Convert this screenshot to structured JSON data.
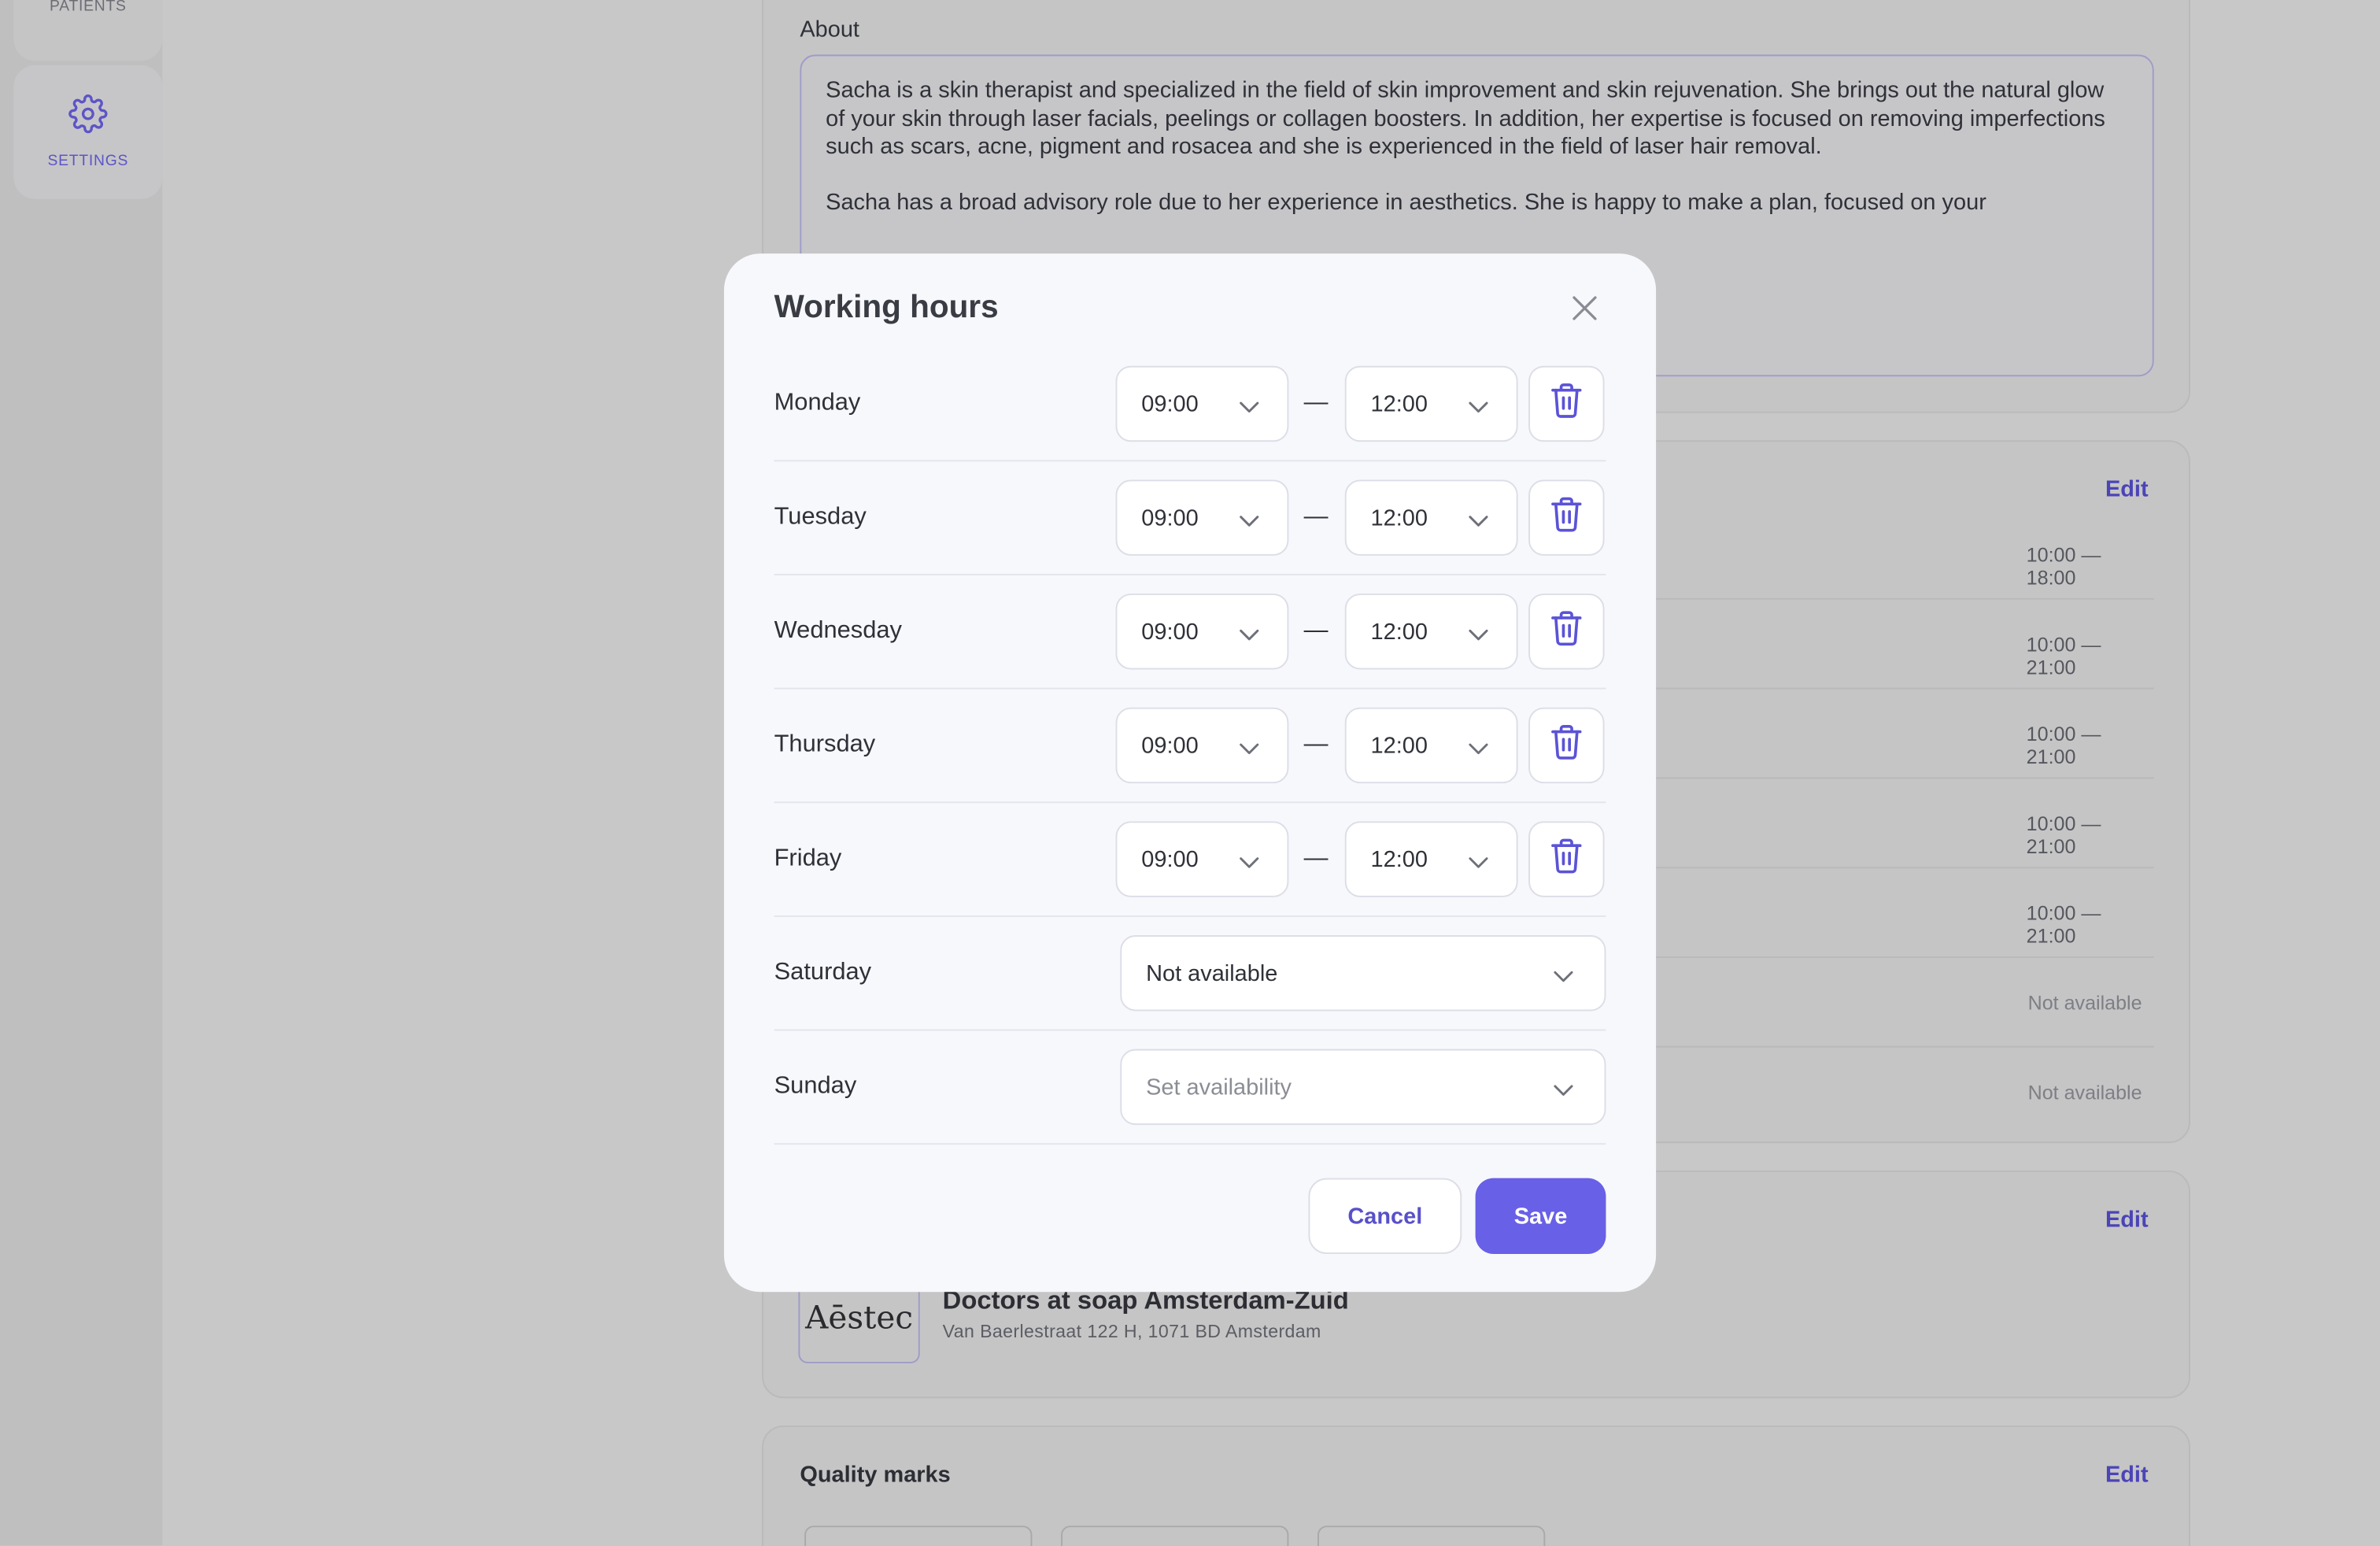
{
  "sidebar": {
    "patients_label": "PATIENTS",
    "settings_label": "SETTINGS",
    "settings_icon": "gear-icon"
  },
  "about": {
    "title": "About",
    "paragraph1": "Sacha is a skin therapist and specialized in the field of skin improvement and skin rejuvenation. She brings out the natural glow of your skin through laser facials, peelings or collagen boosters. In addition, her expertise is focused on removing imperfections such as scars, acne, pigment and rosacea and she is experienced in the field of laser hair removal.",
    "paragraph2": "Sacha has a broad advisory role due to her experience in aesthetics. She is happy to make a plan, focused on your"
  },
  "working_hours_panel": {
    "edit_label": "Edit",
    "hours": [
      "10:00 — 18:00",
      "10:00 — 21:00",
      "10:00 — 21:00",
      "10:00 — 21:00",
      "10:00 — 21:00",
      "Not available",
      "Not available"
    ]
  },
  "clinic_panel": {
    "edit_label": "Edit",
    "logo_text": "Aēstec",
    "name": "Doctors at soap Amsterdam-Zuid",
    "address": "Van Baerlestraat 122 H, 1071 BD Amsterdam"
  },
  "quality_marks": {
    "title": "Quality marks",
    "edit_label": "Edit"
  },
  "modal": {
    "title": "Working hours",
    "days": [
      {
        "day": "Monday",
        "from": "09:00",
        "to": "12:00"
      },
      {
        "day": "Tuesday",
        "from": "09:00",
        "to": "12:00"
      },
      {
        "day": "Wednesday",
        "from": "09:00",
        "to": "12:00"
      },
      {
        "day": "Thursday",
        "from": "09:00",
        "to": "12:00"
      },
      {
        "day": "Friday",
        "from": "09:00",
        "to": "12:00"
      },
      {
        "day": "Saturday",
        "value": "Not available"
      },
      {
        "day": "Sunday",
        "placeholder": "Set availability"
      }
    ],
    "separator": "—",
    "cancel_label": "Cancel",
    "save_label": "Save"
  },
  "colors": {
    "accent": "#6860e6",
    "accent_text": "#5850c9",
    "overlay": "#c8c8c8",
    "modal_bg": "#f7f8fc"
  }
}
